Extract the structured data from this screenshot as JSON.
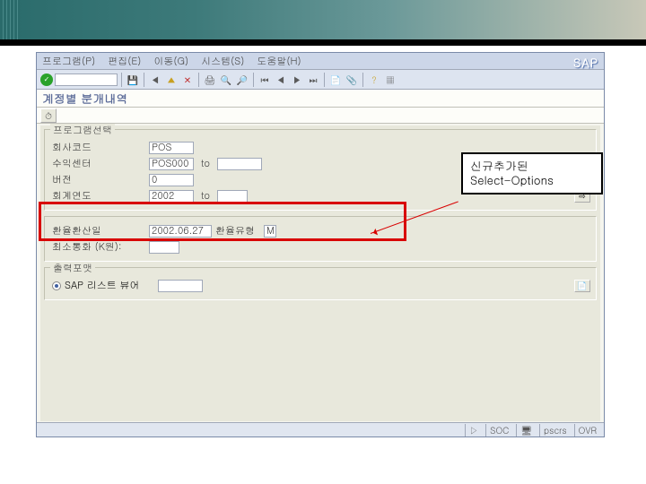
{
  "header": {
    "brand": "SAP"
  },
  "menubar": {
    "items": [
      "프로그램(P)",
      "편집(E)",
      "이동(G)",
      "시스템(S)",
      "도움말(H)"
    ]
  },
  "screen": {
    "title": "계정별 분개내역"
  },
  "group_sel": {
    "title": "프로그램선택",
    "rows": {
      "company": {
        "label": "회사코드",
        "val": "POS"
      },
      "profit": {
        "label": "수익센터",
        "val": "POS000",
        "to": "to",
        "hi": ""
      },
      "version": {
        "label": "버전",
        "val": "0"
      },
      "fy": {
        "label": "회계연도",
        "val": "2002",
        "to": "to",
        "hi": ""
      }
    }
  },
  "group_new": {
    "rows": {
      "rate_date": {
        "label": "환율환산일",
        "val": "2002.06.27",
        "label2": "환율유형",
        "val2": "M"
      },
      "min_curr": {
        "label": "최소통화 (K원):",
        "val": ""
      }
    }
  },
  "group_out": {
    "title": "출력포맷",
    "radio": {
      "label": "SAP 리스트 뷰어",
      "val": ""
    }
  },
  "annotation": {
    "line1": "신규추가된",
    "line2": "Select-Options"
  },
  "status": {
    "sys": "SOC",
    "client": "pscrs",
    "mode": "OVR"
  }
}
